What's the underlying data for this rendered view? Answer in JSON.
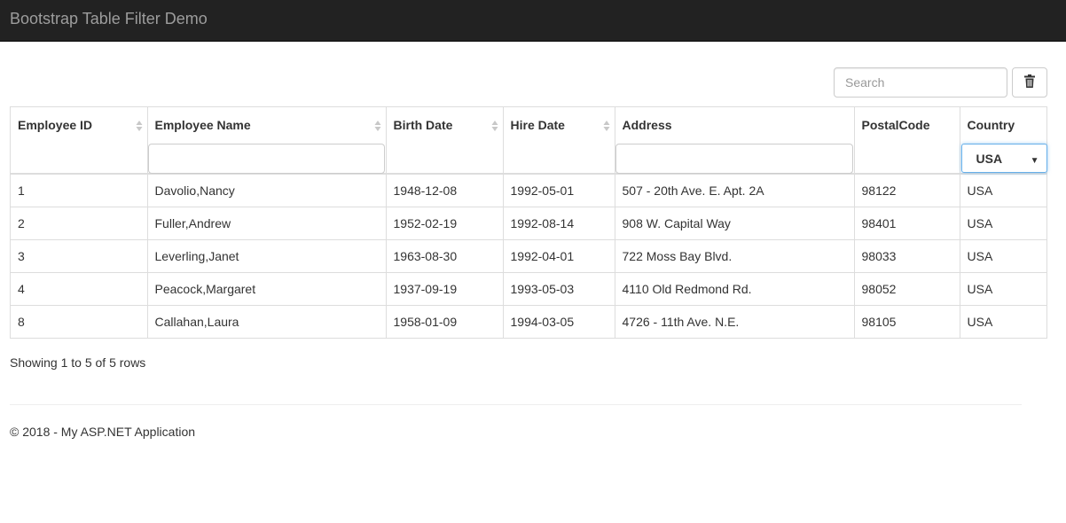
{
  "navbar": {
    "brand": "Bootstrap Table Filter Demo"
  },
  "toolbar": {
    "search_placeholder": "Search",
    "clear_icon": "trash-icon"
  },
  "table": {
    "columns": [
      {
        "label": "Employee ID",
        "sortable": true,
        "filter": "none"
      },
      {
        "label": "Employee Name",
        "sortable": true,
        "filter": "input"
      },
      {
        "label": "Birth Date",
        "sortable": true,
        "filter": "none"
      },
      {
        "label": "Hire Date",
        "sortable": true,
        "filter": "none"
      },
      {
        "label": "Address",
        "sortable": false,
        "filter": "input"
      },
      {
        "label": "PostalCode",
        "sortable": false,
        "filter": "none"
      },
      {
        "label": "Country",
        "sortable": false,
        "filter": "select"
      }
    ],
    "country_filter_value": "USA",
    "rows": [
      [
        "1",
        "Davolio,Nancy",
        "1948-12-08",
        "1992-05-01",
        "507 - 20th Ave. E. Apt. 2A",
        "98122",
        "USA"
      ],
      [
        "2",
        "Fuller,Andrew",
        "1952-02-19",
        "1992-08-14",
        "908 W. Capital Way",
        "98401",
        "USA"
      ],
      [
        "3",
        "Leverling,Janet",
        "1963-08-30",
        "1992-04-01",
        "722 Moss Bay Blvd.",
        "98033",
        "USA"
      ],
      [
        "4",
        "Peacock,Margaret",
        "1937-09-19",
        "1993-05-03",
        "4110 Old Redmond Rd.",
        "98052",
        "USA"
      ],
      [
        "8",
        "Callahan,Laura",
        "1958-01-09",
        "1994-03-05",
        "4726 - 11th Ave. N.E.",
        "98105",
        "USA"
      ]
    ]
  },
  "pagination": {
    "info": "Showing 1 to 5 of 5 rows"
  },
  "footer": {
    "text": "© 2018 - My ASP.NET Application"
  },
  "colors": {
    "navbar_bg": "#222222",
    "brand_text": "#9d9d9d",
    "border": "#dddddd",
    "focus": "#66afe9"
  }
}
